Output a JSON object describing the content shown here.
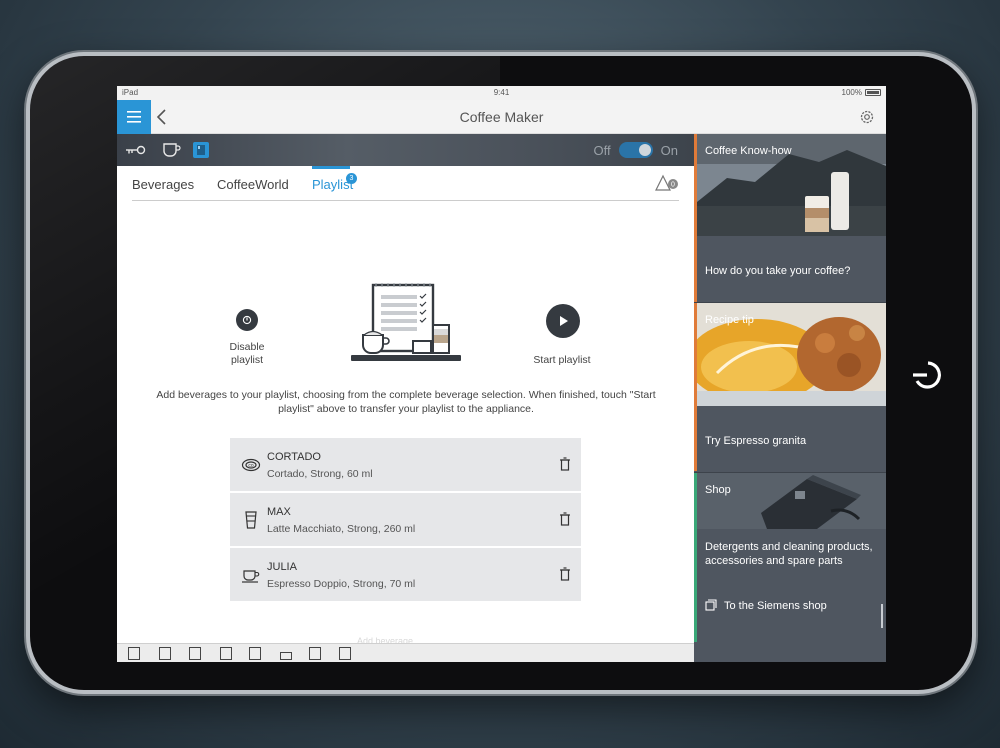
{
  "status_bar": {
    "device": "iPad",
    "time": "9:41",
    "battery": "100%"
  },
  "nav": {
    "title": "Coffee Maker"
  },
  "appliance_bar": {
    "off_label": "Off",
    "on_label": "On",
    "power_state": "on"
  },
  "tabs": [
    {
      "label": "Beverages",
      "active": false
    },
    {
      "label": "CoffeeWorld",
      "active": false
    },
    {
      "label": "Playlist",
      "active": true,
      "badge": "3"
    }
  ],
  "alert_badge": "0",
  "actions": {
    "disable_label": "Disable playlist",
    "start_label": "Start playlist"
  },
  "description": "Add beverages to your playlist, choosing from the complete beverage selection. When finished, touch \"Start playlist\" above to transfer your playlist to the appliance.",
  "playlist": [
    {
      "name": "CORTADO",
      "detail": "Cortado, Strong, 60 ml",
      "icon": "cortado-cup-icon"
    },
    {
      "name": "MAX",
      "detail": "Latte Macchiato, Strong, 260 ml",
      "icon": "tall-glass-icon"
    },
    {
      "name": "JULIA",
      "detail": "Espresso Doppio, Strong, 70 ml",
      "icon": "espresso-cup-icon"
    }
  ],
  "add_beverage_ghost": "Add beverage",
  "right_panel": {
    "knowhow": {
      "title": "Coffee Know-how",
      "link": "How do you take your coffee?"
    },
    "recipe": {
      "title": "Recipe tip",
      "link": "Try Espresso granita"
    },
    "shop": {
      "title": "Shop",
      "text": "Detergents and cleaning products, accessories and spare parts",
      "link": "To the Siemens shop"
    }
  },
  "colors": {
    "accent_blue": "#2a95d6",
    "accent_orange": "#e07b39",
    "accent_green": "#3aa878",
    "panel_bg": "#4f5660"
  }
}
